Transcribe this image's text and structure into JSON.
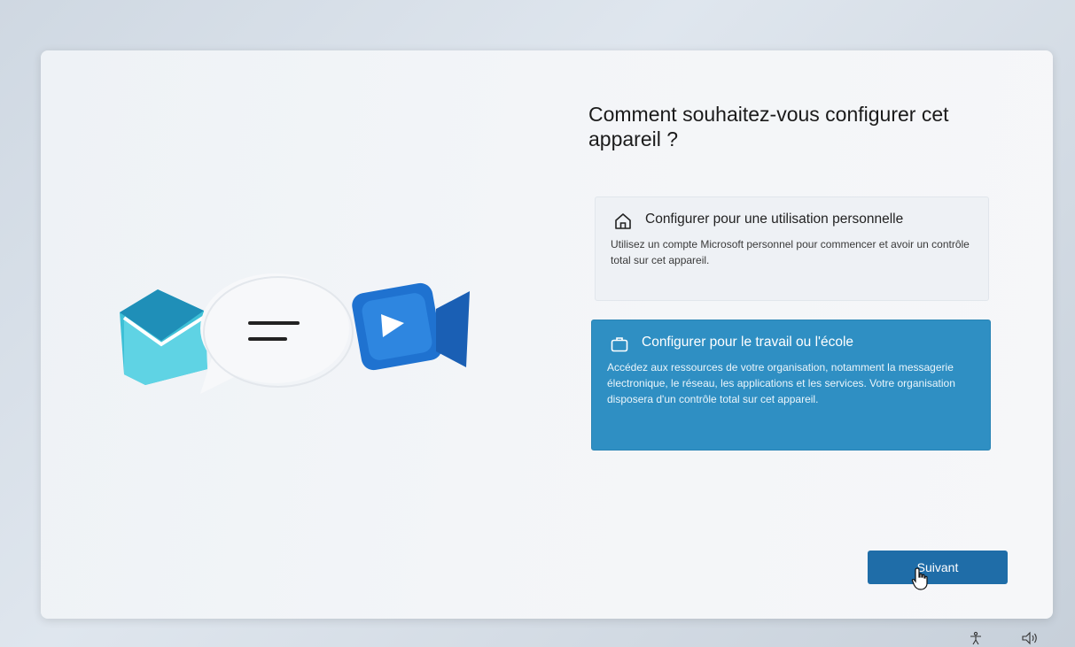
{
  "dialog": {
    "title": "Comment souhaitez-vous configurer cet appareil ?"
  },
  "options": [
    {
      "icon": "home-icon",
      "title": "Configurer pour une utilisation personnelle",
      "description": "Utilisez un compte Microsoft personnel pour commencer et avoir un contrôle total sur cet appareil.",
      "selected": false
    },
    {
      "icon": "briefcase-icon",
      "title": "Configurer pour le travail ou l'école",
      "description": "Accédez aux ressources de votre organisation, notamment la messagerie électronique, le réseau, les applications et les services. Votre organisation disposera d'un contrôle total sur cet appareil.",
      "selected": true
    }
  ],
  "footer": {
    "next_label": "Suivant"
  },
  "taskbar": {
    "icons": [
      "accessibility-icon",
      "volume-icon"
    ]
  },
  "colors": {
    "accent": "#1f6da8",
    "selected_option": "#2f8fc3"
  }
}
